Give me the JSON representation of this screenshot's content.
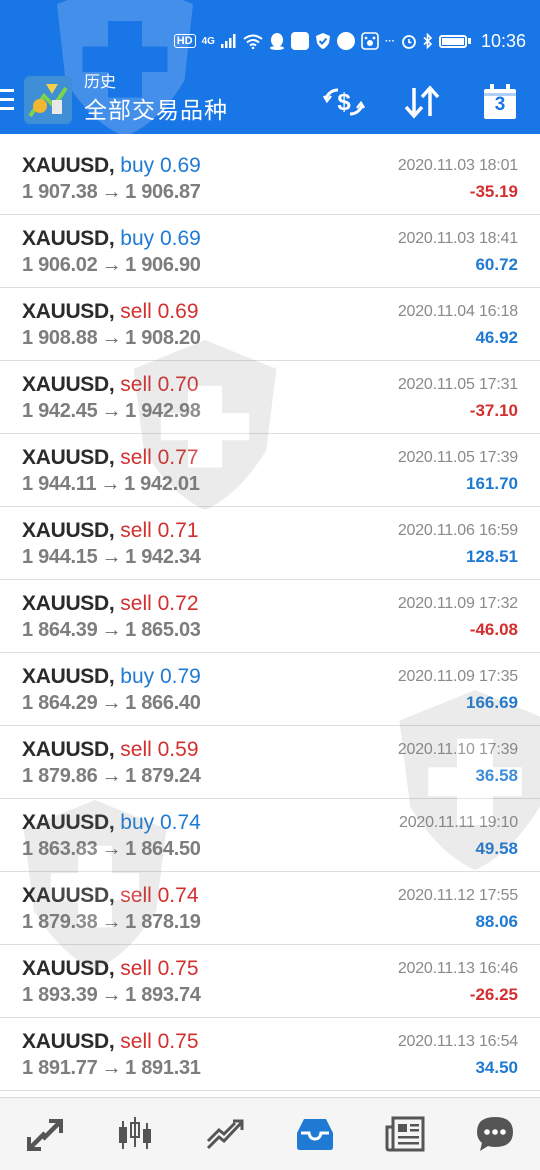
{
  "status_bar": {
    "hd_badge": "HD",
    "network": "4G",
    "time": "10:36"
  },
  "header": {
    "subtitle": "历史",
    "title": "全部交易品种",
    "badge_number": "3"
  },
  "trades": [
    {
      "symbol": "XAUUSD,",
      "side": "buy",
      "volume": "0.69",
      "open": "1 907.38",
      "close": "1 906.87",
      "time": "2020.11.03 18:01",
      "profit": "-35.19"
    },
    {
      "symbol": "XAUUSD,",
      "side": "buy",
      "volume": "0.69",
      "open": "1 906.02",
      "close": "1 906.90",
      "time": "2020.11.03 18:41",
      "profit": "60.72"
    },
    {
      "symbol": "XAUUSD,",
      "side": "sell",
      "volume": "0.69",
      "open": "1 908.88",
      "close": "1 908.20",
      "time": "2020.11.04 16:18",
      "profit": "46.92"
    },
    {
      "symbol": "XAUUSD,",
      "side": "sell",
      "volume": "0.70",
      "open": "1 942.45",
      "close": "1 942.98",
      "time": "2020.11.05 17:31",
      "profit": "-37.10"
    },
    {
      "symbol": "XAUUSD,",
      "side": "sell",
      "volume": "0.77",
      "open": "1 944.11",
      "close": "1 942.01",
      "time": "2020.11.05 17:39",
      "profit": "161.70"
    },
    {
      "symbol": "XAUUSD,",
      "side": "sell",
      "volume": "0.71",
      "open": "1 944.15",
      "close": "1 942.34",
      "time": "2020.11.06 16:59",
      "profit": "128.51"
    },
    {
      "symbol": "XAUUSD,",
      "side": "sell",
      "volume": "0.72",
      "open": "1 864.39",
      "close": "1 865.03",
      "time": "2020.11.09 17:32",
      "profit": "-46.08"
    },
    {
      "symbol": "XAUUSD,",
      "side": "buy",
      "volume": "0.79",
      "open": "1 864.29",
      "close": "1 866.40",
      "time": "2020.11.09 17:35",
      "profit": "166.69"
    },
    {
      "symbol": "XAUUSD,",
      "side": "sell",
      "volume": "0.59",
      "open": "1 879.86",
      "close": "1 879.24",
      "time": "2020.11.10 17:39",
      "profit": "36.58"
    },
    {
      "symbol": "XAUUSD,",
      "side": "buy",
      "volume": "0.74",
      "open": "1 863.83",
      "close": "1 864.50",
      "time": "2020.11.11 19:10",
      "profit": "49.58"
    },
    {
      "symbol": "XAUUSD,",
      "side": "sell",
      "volume": "0.74",
      "open": "1 879.38",
      "close": "1 878.19",
      "time": "2020.11.12 17:55",
      "profit": "88.06"
    },
    {
      "symbol": "XAUUSD,",
      "side": "sell",
      "volume": "0.75",
      "open": "1 893.39",
      "close": "1 893.74",
      "time": "2020.11.13 16:46",
      "profit": "-26.25"
    },
    {
      "symbol": "XAUUSD,",
      "side": "sell",
      "volume": "0.75",
      "open": "1 891.77",
      "close": "1 891.31",
      "time": "2020.11.13 16:54",
      "profit": "34.50"
    }
  ],
  "arrow_glyph": "→",
  "colors": {
    "header_bg": "#1976e6",
    "buy": "#1f7ad3",
    "sell": "#d32f2f",
    "profit_positive": "#1f7ad3",
    "profit_negative": "#d32f2f",
    "nav_active": "#1f7ad3",
    "nav_inactive": "#555555"
  },
  "bottom_nav": {
    "items": [
      {
        "icon": "quotes-arrows-icon",
        "active": false
      },
      {
        "icon": "candlestick-chart-icon",
        "active": false
      },
      {
        "icon": "trade-trend-icon",
        "active": false
      },
      {
        "icon": "history-inbox-icon",
        "active": true
      },
      {
        "icon": "news-icon",
        "active": false
      },
      {
        "icon": "chat-bubble-icon",
        "active": false
      }
    ]
  }
}
